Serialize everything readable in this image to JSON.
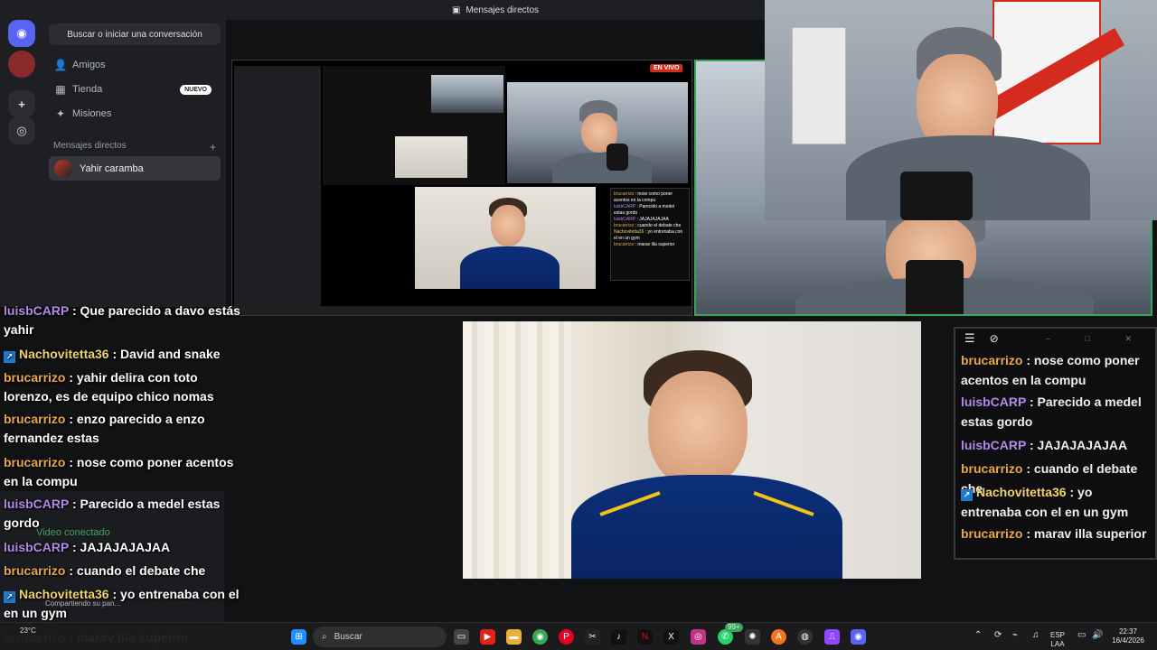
{
  "discord": {
    "top_title": "Mensajes directos",
    "search_label": "Buscar o iniciar una conversación",
    "nav": [
      {
        "label": "Amigos",
        "icon": "friends-icon"
      },
      {
        "label": "Tienda",
        "icon": "shop-icon",
        "badge": "NUEVO"
      },
      {
        "label": "Misiones",
        "icon": "quests-icon"
      }
    ],
    "dm_header": "Mensajes directos",
    "dm_user": "Yahir caramba",
    "voice_status": "Video conectado",
    "voice_sub": "Compartiendo su pan..."
  },
  "stream": {
    "live_badge": "EN VIVO"
  },
  "chat_overlay": [
    {
      "user": "luisbCARP",
      "color": "purple",
      "icon": false,
      "text": "Que parecido a davo estás yahir"
    },
    {
      "user": "Nachovitetta36",
      "color": "gold",
      "icon": true,
      "text": "David and snake"
    },
    {
      "user": "brucarrizo",
      "color": "yellow",
      "icon": false,
      "text": "yahir delira con toto lorenzo, es de equipo chico nomas"
    },
    {
      "user": "brucarrizo",
      "color": "yellow",
      "icon": false,
      "text": "enzo parecido a enzo fernandez estas"
    },
    {
      "user": "brucarrizo",
      "color": "yellow",
      "icon": false,
      "text": "nose como poner acentos en la compu"
    },
    {
      "user": "luisbCARP",
      "color": "purple",
      "icon": false,
      "text": "Parecido a medel estas gordo"
    },
    {
      "user": "luisbCARP",
      "color": "purple",
      "icon": false,
      "text": "JAJAJAJAJAA"
    },
    {
      "user": "brucarrizo",
      "color": "yellow",
      "icon": false,
      "text": "cuando el debate che"
    },
    {
      "user": "Nachovitetta36",
      "color": "gold",
      "icon": true,
      "text": "yo entrenaba con el en un gym"
    },
    {
      "user": "brucarrizo",
      "color": "yellow",
      "icon": false,
      "text": "marav illa superior"
    }
  ],
  "chat_window": [
    {
      "user": "brucarrizo",
      "color": "yellow",
      "icon": false,
      "text": "nose como poner acentos en la compu"
    },
    {
      "user": "luisbCARP",
      "color": "purple",
      "icon": false,
      "text": "Parecido a medel estas gordo"
    },
    {
      "user": "luisbCARP",
      "color": "purple",
      "icon": false,
      "text": "JAJAJAJAJAA"
    },
    {
      "user": "brucarrizo",
      "color": "yellow",
      "icon": false,
      "text": "cuando el debate che"
    },
    {
      "user": "Nachovitetta36",
      "color": "gold",
      "icon": true,
      "text": "yo entrenaba con el en un gym"
    },
    {
      "user": "brucarrizo",
      "color": "yellow",
      "icon": false,
      "text": "marav illa superior"
    }
  ],
  "taskbar": {
    "weather": "23°C",
    "search_placeholder": "Buscar",
    "lang_top": "ESP",
    "lang_bottom": "LAA",
    "time": "22:37",
    "date": "16/4/2026",
    "notification_badge": "99+"
  },
  "colors": {
    "purple": "#b48ae6",
    "yellow": "#e8a84a",
    "gold": "#f0d46a",
    "discord_blurple": "#5865f2",
    "live_red": "#d52b1e"
  }
}
